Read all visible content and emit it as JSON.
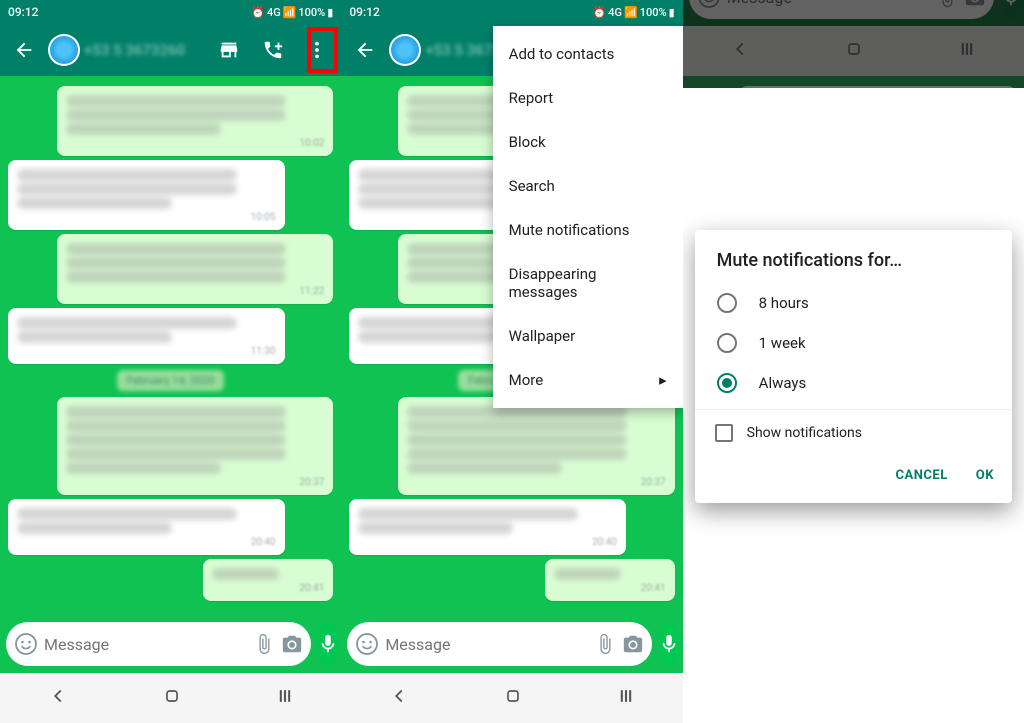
{
  "status": {
    "time": "09:12",
    "battery_pct": "100%",
    "net": "4G"
  },
  "contact": {
    "name": "+53 5 3673260"
  },
  "chat": {
    "input_placeholder": "Message",
    "date_label": "February 14, 2020"
  },
  "menu": {
    "items": [
      {
        "label": "Add to contacts"
      },
      {
        "label": "Report"
      },
      {
        "label": "Block"
      },
      {
        "label": "Search"
      },
      {
        "label": "Mute notifications",
        "highlighted": true
      },
      {
        "label": "Disappearing messages"
      },
      {
        "label": "Wallpaper"
      },
      {
        "label": "More",
        "has_submenu": true
      }
    ]
  },
  "dialog": {
    "title": "Mute notifications for…",
    "options": [
      {
        "label": "8 hours",
        "checked": false
      },
      {
        "label": "1 week",
        "checked": false
      },
      {
        "label": "Always",
        "checked": true
      }
    ],
    "show_notifications_label": "Show notifications",
    "show_notifications_checked": false,
    "cancel": "CANCEL",
    "ok": "OK"
  }
}
